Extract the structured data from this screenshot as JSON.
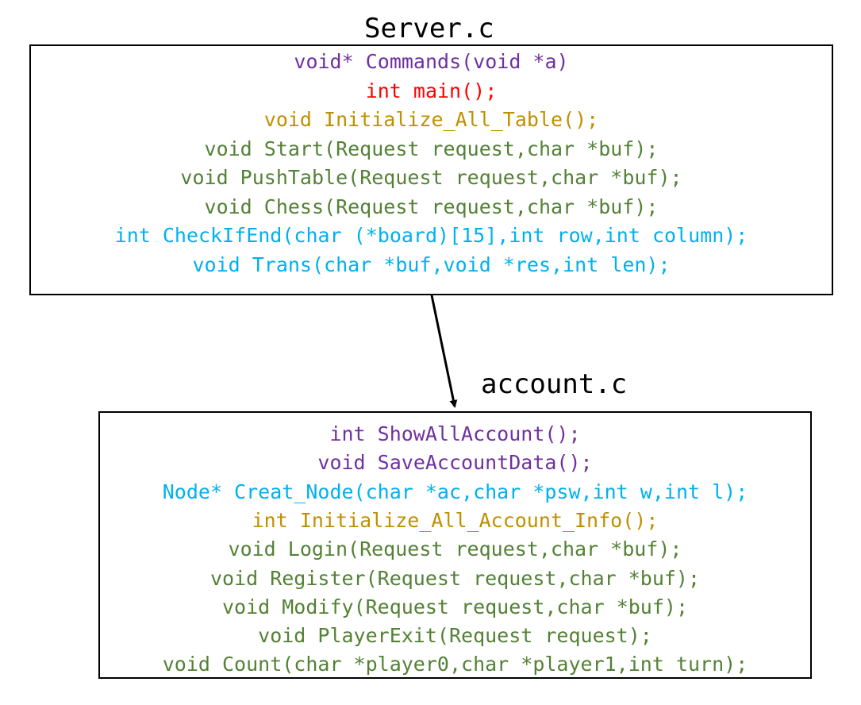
{
  "server": {
    "title": "Server.c",
    "lines": [
      {
        "text": "void* Commands(void *a)",
        "color": "#7030A0"
      },
      {
        "text": "int main();",
        "color": "#FF0000"
      },
      {
        "text": "void Initialize_All_Table();",
        "color": "#BF9000"
      },
      {
        "text": "void Start(Request request,char *buf);",
        "color": "#538135"
      },
      {
        "text": "void PushTable(Request request,char *buf);",
        "color": "#538135"
      },
      {
        "text": "void Chess(Request request,char *buf);",
        "color": "#538135"
      },
      {
        "text": "int CheckIfEnd(char (*board)[15],int row,int column);",
        "color": "#00B0F0"
      },
      {
        "text": "void Trans(char *buf,void *res,int len);",
        "color": "#00B0F0"
      }
    ]
  },
  "account": {
    "title": "account.c",
    "lines": [
      {
        "text": "int ShowAllAccount();",
        "color": "#7030A0"
      },
      {
        "text": "void SaveAccountData();",
        "color": "#7030A0"
      },
      {
        "text": "Node* Creat_Node(char *ac,char *psw,int w,int l);",
        "color": "#00B0F0"
      },
      {
        "text": "int Initialize_All_Account_Info();",
        "color": "#BF9000"
      },
      {
        "text": "void Login(Request request,char *buf);",
        "color": "#538135"
      },
      {
        "text": "void Register(Request request,char *buf);",
        "color": "#538135"
      },
      {
        "text": "void Modify(Request request,char *buf);",
        "color": "#538135"
      },
      {
        "text": "void PlayerExit(Request request);",
        "color": "#538135"
      },
      {
        "text": "void Count(char *player0,char *player1,int turn);",
        "color": "#538135"
      }
    ]
  }
}
